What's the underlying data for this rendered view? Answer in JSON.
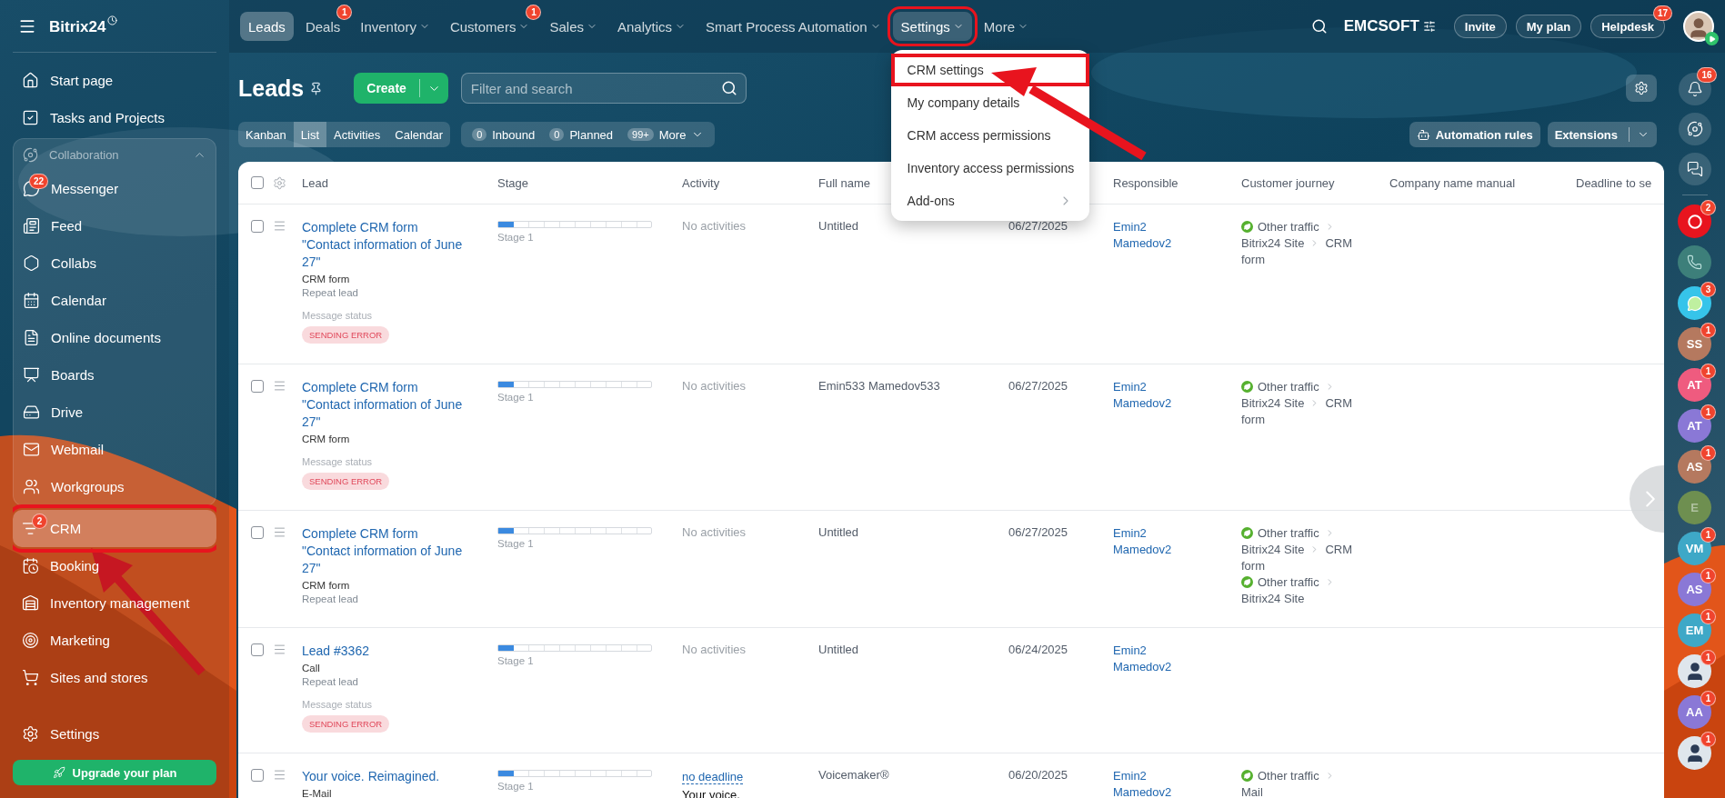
{
  "sidebar": {
    "brand": "Bitrix24",
    "items": [
      {
        "label": "Start page",
        "selected": false
      },
      {
        "label": "Tasks and Projects",
        "selected": false
      },
      {
        "label": "Collaboration",
        "kind": "group",
        "expanded": true,
        "children": [
          {
            "label": "Messenger",
            "selected": false,
            "badge": "22"
          },
          {
            "label": "Feed",
            "selected": false
          },
          {
            "label": "Collabs",
            "selected": false
          },
          {
            "label": "Calendar",
            "selected": false
          },
          {
            "label": "Online documents",
            "selected": false
          },
          {
            "label": "Boards",
            "selected": false
          },
          {
            "label": "Drive",
            "selected": false
          },
          {
            "label": "Webmail",
            "selected": false
          },
          {
            "label": "Workgroups",
            "selected": false
          }
        ]
      },
      {
        "label": "CRM",
        "selected": true,
        "badge": "2",
        "highlighted": true
      },
      {
        "label": "Booking",
        "selected": false
      },
      {
        "label": "Inventory management",
        "selected": false
      },
      {
        "label": "Marketing",
        "selected": false
      },
      {
        "label": "Sites and stores",
        "selected": false
      }
    ],
    "settings": "Settings",
    "upgrade": "Upgrade your plan"
  },
  "top_nav": {
    "items": [
      {
        "label": "Leads",
        "selected": true
      },
      {
        "label": "Deals",
        "selected": false,
        "badge": "1"
      },
      {
        "label": "Inventory",
        "selected": false,
        "dropdown": true
      },
      {
        "label": "Customers",
        "selected": false,
        "dropdown": true,
        "badge": "1"
      },
      {
        "label": "Sales",
        "selected": false,
        "dropdown": true
      },
      {
        "label": "Analytics",
        "selected": false,
        "dropdown": true
      },
      {
        "label": "Smart Process Automation",
        "selected": false,
        "dropdown": true
      },
      {
        "label": "Settings",
        "selected": false,
        "dropdown": true,
        "open": true,
        "highlighted": true,
        "menu": [
          {
            "label": "CRM settings",
            "highlighted": true
          },
          {
            "label": "My company details"
          },
          {
            "label": "CRM access permissions"
          },
          {
            "label": "Inventory access permissions"
          },
          {
            "label": "Add-ons",
            "submenu": true
          }
        ]
      },
      {
        "label": "More",
        "selected": false,
        "dropdown": true
      }
    ],
    "company": "EMCSOFT",
    "buttons": [
      {
        "label": "Invite"
      },
      {
        "label": "My plan"
      },
      {
        "label": "Helpdesk",
        "badge": "17"
      }
    ]
  },
  "page": {
    "title": "Leads",
    "create": "Create",
    "search": {
      "placeholder": "Filter and search"
    },
    "views": [
      {
        "label": "Kanban",
        "selected": false
      },
      {
        "label": "List",
        "selected": true
      },
      {
        "label": "Activities",
        "selected": false
      },
      {
        "label": "Calendar",
        "selected": false
      }
    ],
    "counters": [
      {
        "count": "0",
        "label": "Inbound"
      },
      {
        "count": "0",
        "label": "Planned"
      },
      {
        "count": "99+",
        "label": "More",
        "dropdown": true
      }
    ],
    "automation": "Automation rules",
    "extensions": "Extensions"
  },
  "table": {
    "all_checked": false,
    "columns": [
      {
        "label": "Lead"
      },
      {
        "label": "Stage"
      },
      {
        "label": "Activity"
      },
      {
        "label": "Full name"
      },
      {
        "label": "Responsible"
      },
      {
        "label": "Customer journey"
      },
      {
        "label": "Company name manual"
      },
      {
        "label": "Deadline to se"
      }
    ],
    "rows": [
      {
        "checked": false,
        "title": "Complete CRM form \"Contact information of June 27\"",
        "lines": [
          "CRM form"
        ],
        "notes": [
          "Repeat lead"
        ],
        "status_label": "Message status",
        "status": "SENDING ERROR",
        "stage": "Stage 1",
        "level": 0.1,
        "activity": "No activities",
        "full_name": "Untitled",
        "date": "06/27/2025",
        "responsible": "Emin2 Mamedov2",
        "journeys": [
          [
            "Other traffic",
            "Bitrix24 Site",
            "CRM form"
          ]
        ]
      },
      {
        "checked": false,
        "title": "Complete CRM form \"Contact information of June 27\"",
        "lines": [
          "CRM form"
        ],
        "status_label": "Message status",
        "status": "SENDING ERROR",
        "stage": "Stage 1",
        "level": 0.1,
        "activity": "No activities",
        "full_name": "Emin533 Mamedov533",
        "date": "06/27/2025",
        "responsible": "Emin2 Mamedov2",
        "journeys": [
          [
            "Other traffic",
            "Bitrix24 Site",
            "CRM form"
          ]
        ]
      },
      {
        "checked": false,
        "title": "Complete CRM form \"Contact information of June 27\"",
        "lines": [
          "CRM form"
        ],
        "notes": [
          "Repeat lead"
        ],
        "stage": "Stage 1",
        "level": 0.1,
        "activity": "No activities",
        "full_name": "Untitled",
        "date": "06/27/2025",
        "responsible": "Emin2 Mamedov2",
        "journeys": [
          [
            "Other traffic",
            "Bitrix24 Site",
            "CRM form"
          ],
          [
            "Other traffic",
            "Bitrix24 Site"
          ]
        ]
      },
      {
        "checked": false,
        "title": "Lead #3362",
        "lines": [
          "Call"
        ],
        "notes": [
          "Repeat lead"
        ],
        "status_label": "Message status",
        "status": "SENDING ERROR",
        "stage": "Stage 1",
        "level": 0.1,
        "activity": "No activities",
        "full_name": "Untitled",
        "date": "06/24/2025",
        "responsible": "Emin2 Mamedov2"
      },
      {
        "checked": false,
        "title": "Your voice. Reimagined.",
        "lines": [
          "E-Mail"
        ],
        "stage": "Stage 1",
        "level": 0.1,
        "activity_link": "no deadline",
        "activity": "Your voice.",
        "full_name": "Voicemaker®",
        "date": "06/20/2025",
        "responsible": "Emin2 Mamedov2",
        "journeys": [
          [
            "Other traffic",
            "Mail"
          ]
        ]
      }
    ]
  },
  "right_rail": {
    "notifications_badge": "16",
    "items": [
      {
        "kind": "record",
        "badge": "2"
      },
      {
        "kind": "phone"
      },
      {
        "kind": "chat",
        "badge": "3"
      },
      {
        "kind": "initials",
        "text": "SS",
        "color": "#b5795f",
        "badge": "1"
      },
      {
        "kind": "initials",
        "text": "AT",
        "color": "#ef5b7f",
        "badge": "1"
      },
      {
        "kind": "initials",
        "text": "AT",
        "color": "#8a78d6",
        "badge": "1"
      },
      {
        "kind": "initials",
        "text": "AS",
        "color": "#b5795f",
        "badge": "1"
      },
      {
        "kind": "initials",
        "text": "E",
        "color": "#6e8f50",
        "dimmed": true
      },
      {
        "kind": "initials",
        "text": "VM",
        "color": "#3ea8c7",
        "badge": "1"
      },
      {
        "kind": "initials",
        "text": "AS",
        "color": "#8a78d6",
        "badge": "1"
      },
      {
        "kind": "initials",
        "text": "EM",
        "color": "#3ea8c7",
        "badge": "1"
      },
      {
        "badge": "1"
      },
      {
        "kind": "initials",
        "text": "AA",
        "color": "#8a78d6",
        "badge": "1"
      },
      {
        "badge": "1"
      }
    ]
  }
}
